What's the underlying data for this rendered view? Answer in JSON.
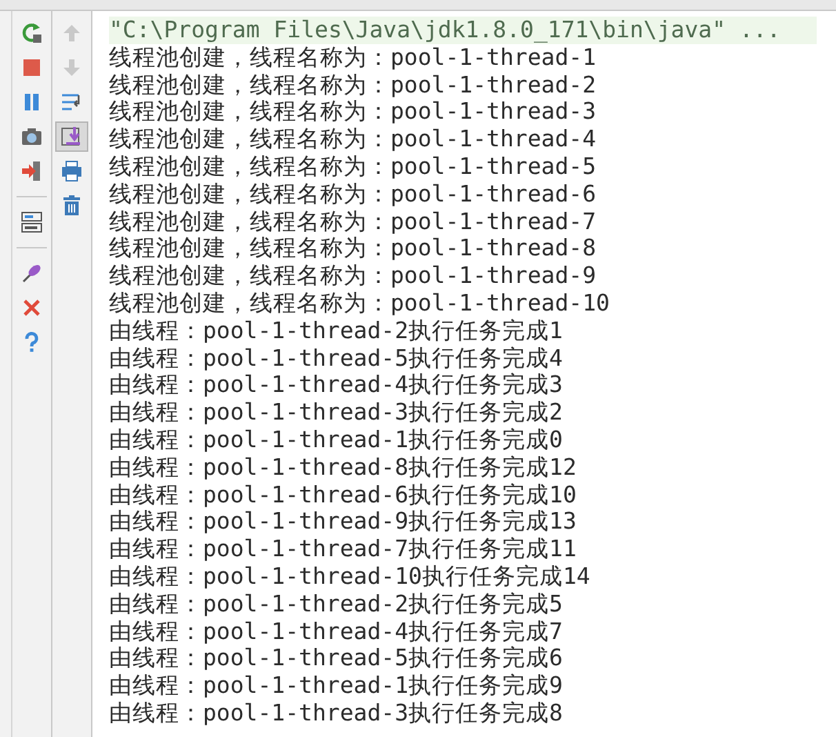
{
  "left_toolbar": [
    {
      "kind": "rerun"
    },
    {
      "kind": "stop"
    },
    {
      "kind": "pause"
    },
    {
      "kind": "camera"
    },
    {
      "kind": "exit"
    },
    {
      "kind": "divider"
    },
    {
      "kind": "layout"
    },
    {
      "kind": "divider"
    },
    {
      "kind": "pin"
    },
    {
      "kind": "close"
    },
    {
      "kind": "help"
    }
  ],
  "right_toolbar": [
    {
      "kind": "up",
      "disabled": true,
      "on": false
    },
    {
      "kind": "down",
      "disabled": true,
      "on": false
    },
    {
      "kind": "wrap",
      "disabled": false,
      "on": false
    },
    {
      "kind": "scroll",
      "disabled": false,
      "on": true
    },
    {
      "kind": "print",
      "disabled": false,
      "on": false
    },
    {
      "kind": "trash",
      "disabled": false,
      "on": false
    }
  ],
  "console": {
    "command": "\"C:\\Program Files\\Java\\jdk1.8.0_171\\bin\\java\" ...",
    "lines": [
      "线程池创建，线程名称为：pool-1-thread-1",
      "线程池创建，线程名称为：pool-1-thread-2",
      "线程池创建，线程名称为：pool-1-thread-3",
      "线程池创建，线程名称为：pool-1-thread-4",
      "线程池创建，线程名称为：pool-1-thread-5",
      "线程池创建，线程名称为：pool-1-thread-6",
      "线程池创建，线程名称为：pool-1-thread-7",
      "线程池创建，线程名称为：pool-1-thread-8",
      "线程池创建，线程名称为：pool-1-thread-9",
      "线程池创建，线程名称为：pool-1-thread-10",
      "由线程：pool-1-thread-2执行任务完成1",
      "由线程：pool-1-thread-5执行任务完成4",
      "由线程：pool-1-thread-4执行任务完成3",
      "由线程：pool-1-thread-3执行任务完成2",
      "由线程：pool-1-thread-1执行任务完成0",
      "由线程：pool-1-thread-8执行任务完成12",
      "由线程：pool-1-thread-6执行任务完成10",
      "由线程：pool-1-thread-9执行任务完成13",
      "由线程：pool-1-thread-7执行任务完成11",
      "由线程：pool-1-thread-10执行任务完成14",
      "由线程：pool-1-thread-2执行任务完成5",
      "由线程：pool-1-thread-4执行任务完成7",
      "由线程：pool-1-thread-5执行任务完成6",
      "由线程：pool-1-thread-1执行任务完成9",
      "由线程：pool-1-thread-3执行任务完成8"
    ]
  }
}
